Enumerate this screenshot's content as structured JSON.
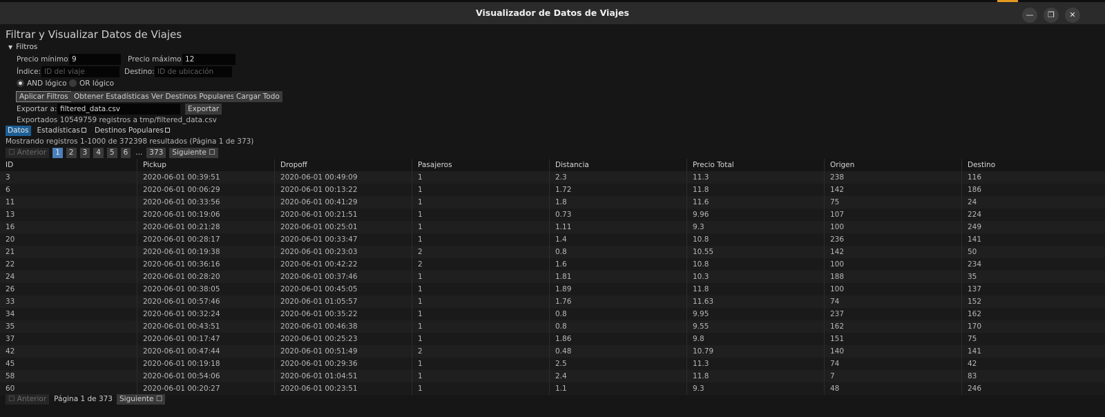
{
  "window": {
    "title": "Visualizador de Datos de Viajes",
    "minimize_glyph": "—",
    "maximize_glyph": "❐",
    "close_glyph": "✕"
  },
  "page": {
    "title": "Filtrar y Visualizar Datos de Viajes"
  },
  "filters": {
    "header": "Filtros",
    "precio_min_label": "Precio mínimo:",
    "precio_min_value": "9",
    "precio_max_label": "Precio máximo:",
    "precio_max_value": "12",
    "indice_label": "Índice:",
    "indice_placeholder": "ID del viaje",
    "destino_label": "Destino:",
    "destino_placeholder": "ID de ubicación",
    "and_label": "AND lógico",
    "or_label": "OR lógico",
    "and_selected": true
  },
  "actions": {
    "apply": "Aplicar Filtros",
    "stats": "Obtener Estadísticas",
    "popular": "Ver Destinos Populares",
    "load_all": "Cargar Todo"
  },
  "export": {
    "label": "Exportar a:",
    "value": "filtered_data.csv",
    "button": "Exportar",
    "status": "Exportados 10549759 registros a tmp/filtered_data.csv"
  },
  "tabs": [
    "Datos",
    "Estadísticas",
    "Destinos Populares"
  ],
  "results": {
    "summary": "Mostrando registros 1-1000 de 372398 resultados (Página 1 de 373)",
    "prev": "Anterior",
    "next": "Siguiente",
    "pages": [
      "1",
      "2",
      "3",
      "4",
      "5",
      "6"
    ],
    "ellipsis": "...",
    "last_page": "373",
    "page_indicator": "Página 1 de 373"
  },
  "table": {
    "columns": [
      "ID",
      "Pickup",
      "Dropoff",
      "Pasajeros",
      "Distancia",
      "Precio Total",
      "Origen",
      "Destino"
    ],
    "rows": [
      [
        "3",
        "2020-06-01 00:39:51",
        "2020-06-01 00:49:09",
        "1",
        "2.3",
        "11.3",
        "238",
        "116"
      ],
      [
        "6",
        "2020-06-01 00:06:29",
        "2020-06-01 00:13:22",
        "1",
        "1.72",
        "11.8",
        "142",
        "186"
      ],
      [
        "11",
        "2020-06-01 00:33:56",
        "2020-06-01 00:41:29",
        "1",
        "1.8",
        "11.6",
        "75",
        "24"
      ],
      [
        "13",
        "2020-06-01 00:19:06",
        "2020-06-01 00:21:51",
        "1",
        "0.73",
        "9.96",
        "107",
        "224"
      ],
      [
        "16",
        "2020-06-01 00:21:28",
        "2020-06-01 00:25:01",
        "1",
        "1.11",
        "9.3",
        "100",
        "249"
      ],
      [
        "20",
        "2020-06-01 00:28:17",
        "2020-06-01 00:33:47",
        "1",
        "1.4",
        "10.8",
        "236",
        "141"
      ],
      [
        "21",
        "2020-06-01 00:19:38",
        "2020-06-01 00:23:03",
        "2",
        "0.8",
        "10.55",
        "142",
        "50"
      ],
      [
        "22",
        "2020-06-01 00:36:16",
        "2020-06-01 00:42:22",
        "2",
        "1.6",
        "10.8",
        "100",
        "234"
      ],
      [
        "24",
        "2020-06-01 00:28:20",
        "2020-06-01 00:37:46",
        "1",
        "1.81",
        "10.3",
        "188",
        "35"
      ],
      [
        "26",
        "2020-06-01 00:38:05",
        "2020-06-01 00:45:05",
        "1",
        "1.89",
        "11.8",
        "100",
        "137"
      ],
      [
        "33",
        "2020-06-01 00:57:46",
        "2020-06-01 01:05:57",
        "1",
        "1.76",
        "11.63",
        "74",
        "152"
      ],
      [
        "34",
        "2020-06-01 00:32:24",
        "2020-06-01 00:35:22",
        "1",
        "0.8",
        "9.95",
        "237",
        "162"
      ],
      [
        "35",
        "2020-06-01 00:43:51",
        "2020-06-01 00:46:38",
        "1",
        "0.8",
        "9.55",
        "162",
        "170"
      ],
      [
        "37",
        "2020-06-01 00:17:47",
        "2020-06-01 00:25:23",
        "1",
        "1.86",
        "9.8",
        "151",
        "75"
      ],
      [
        "42",
        "2020-06-01 00:47:44",
        "2020-06-01 00:51:49",
        "2",
        "0.48",
        "10.79",
        "140",
        "141"
      ],
      [
        "45",
        "2020-06-01 00:19:18",
        "2020-06-01 00:29:36",
        "1",
        "2.5",
        "11.3",
        "74",
        "42"
      ],
      [
        "58",
        "2020-06-01 00:54:06",
        "2020-06-01 01:04:51",
        "1",
        "2.4",
        "11.8",
        "7",
        "83"
      ],
      [
        "60",
        "2020-06-01 00:20:27",
        "2020-06-01 00:23:51",
        "1",
        "1.1",
        "9.3",
        "48",
        "246"
      ]
    ]
  }
}
